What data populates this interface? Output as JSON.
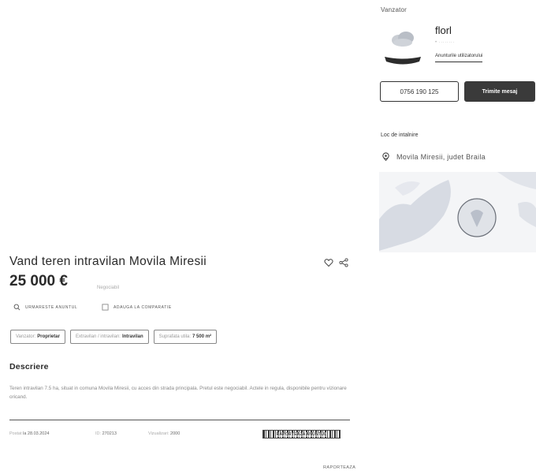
{
  "seller": {
    "heading": "Vanzator",
    "name": "florl",
    "meta": "• ········",
    "ads_link": "Anunturile utilizatorului",
    "phone_button": "0756 190 125",
    "message_button": "Trimite mesaj",
    "icons": {
      "avatar": "avatar-cloud-icon",
      "logo": "brand-logo"
    }
  },
  "location": {
    "heading": "Loc de intalnire",
    "place": "Movila Miresii, judet Braila",
    "icon": "map-pin-icon"
  },
  "listing": {
    "title": "Vand teren intravilan Movila Miresii",
    "price": "25 000 €",
    "negotiable": "Negociabil",
    "actions": {
      "favorite_label": "Urmareste anuntul",
      "compare_label": "Adauga la comparatie"
    },
    "chips": [
      {
        "label": "Vanzator",
        "value": "Proprietar"
      },
      {
        "label": "Extravilan / intravilan",
        "value": "Intravilan"
      },
      {
        "label": "Suprafata utila",
        "value": "7 500 m²"
      }
    ],
    "description_heading": "Descriere",
    "description": "Teren intravilan 7.5 ha, situat in comuna Movila Miresii, cu acces din strada principala. Pretul este negociabil. Actele in regula, disponibile pentru vizionare oricand.",
    "footer": {
      "posted_label": "Postat",
      "posted_value": "la 28.03.2024",
      "id_label": "ID:",
      "id_value": "270213",
      "views_label": "Vizualizari:",
      "views_value": "2000"
    },
    "report_badge": "RAPORTEAZA ANUNTUL",
    "report_link": "Raporteaza"
  },
  "colors": {
    "primary_button": "#3a3a3a",
    "text": "#2a2a2a",
    "muted": "#aaaaaa",
    "map_land": "#d7dbe3"
  }
}
